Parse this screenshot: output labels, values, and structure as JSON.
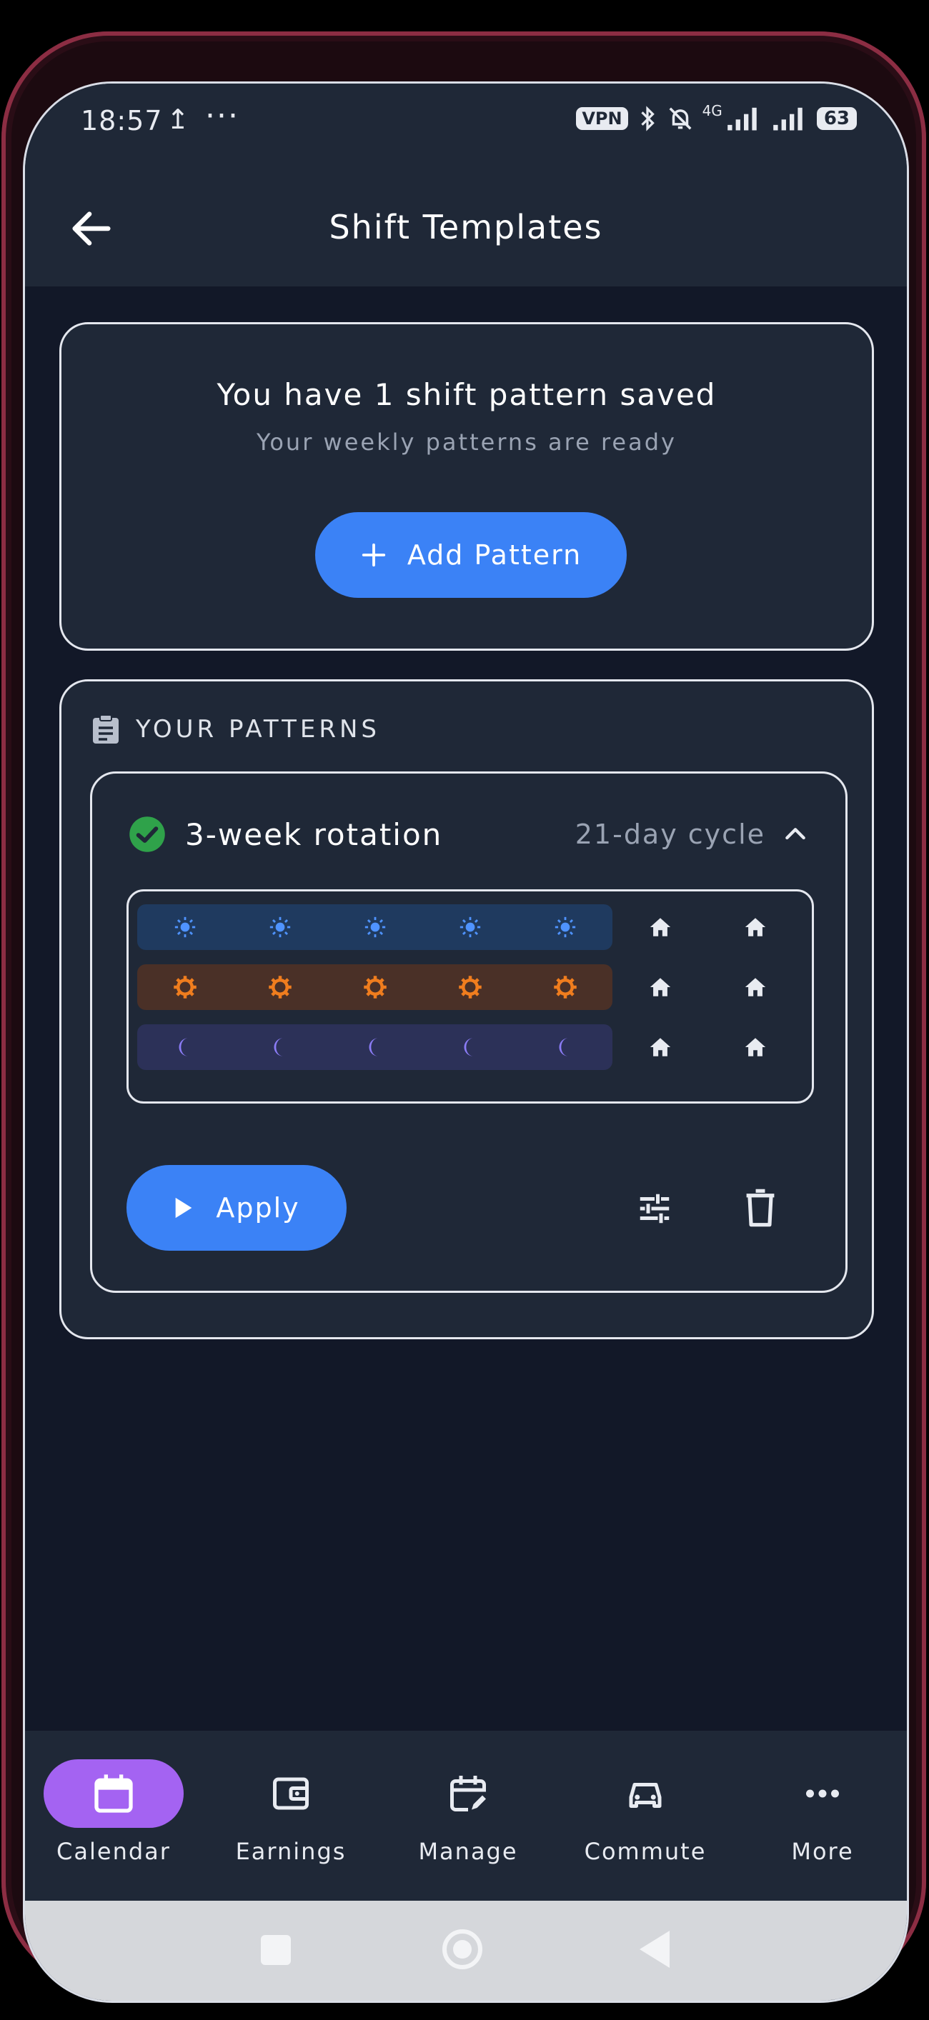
{
  "status_bar": {
    "time": "18:57",
    "upload_glyph": "↥",
    "dots": "···",
    "vpn": "VPN",
    "network": "4G",
    "battery": "63"
  },
  "app_bar": {
    "title": "Shift Templates"
  },
  "summary": {
    "title": "You have 1 shift pattern saved",
    "subtitle": "Your weekly patterns are ready",
    "add_button_label": "Add Pattern"
  },
  "patterns_section": {
    "heading": "YOUR PATTERNS",
    "items": [
      {
        "name": "3-week rotation",
        "cycle": "21-day cycle",
        "weeks": [
          [
            "day",
            "day",
            "day",
            "day",
            "day",
            "off",
            "off"
          ],
          [
            "mid",
            "mid",
            "mid",
            "mid",
            "mid",
            "off",
            "off"
          ],
          [
            "night",
            "night",
            "night",
            "night",
            "night",
            "off",
            "off"
          ]
        ],
        "apply_label": "Apply"
      }
    ]
  },
  "bottom_nav": [
    {
      "label": "Calendar",
      "icon": "calendar-icon",
      "active": true
    },
    {
      "label": "Earnings",
      "icon": "wallet-icon",
      "active": false
    },
    {
      "label": "Manage",
      "icon": "edit-calendar-icon",
      "active": false
    },
    {
      "label": "Commute",
      "icon": "car-icon",
      "active": false
    },
    {
      "label": "More",
      "icon": "more-icon",
      "active": false
    }
  ],
  "colors": {
    "accent": "#3b82f6",
    "active_nav": "#a463f2",
    "day_shift": "#4f93ff",
    "mid_shift": "#f07d1e",
    "night_shift": "#8b7cf6",
    "success": "#2fa24a"
  }
}
